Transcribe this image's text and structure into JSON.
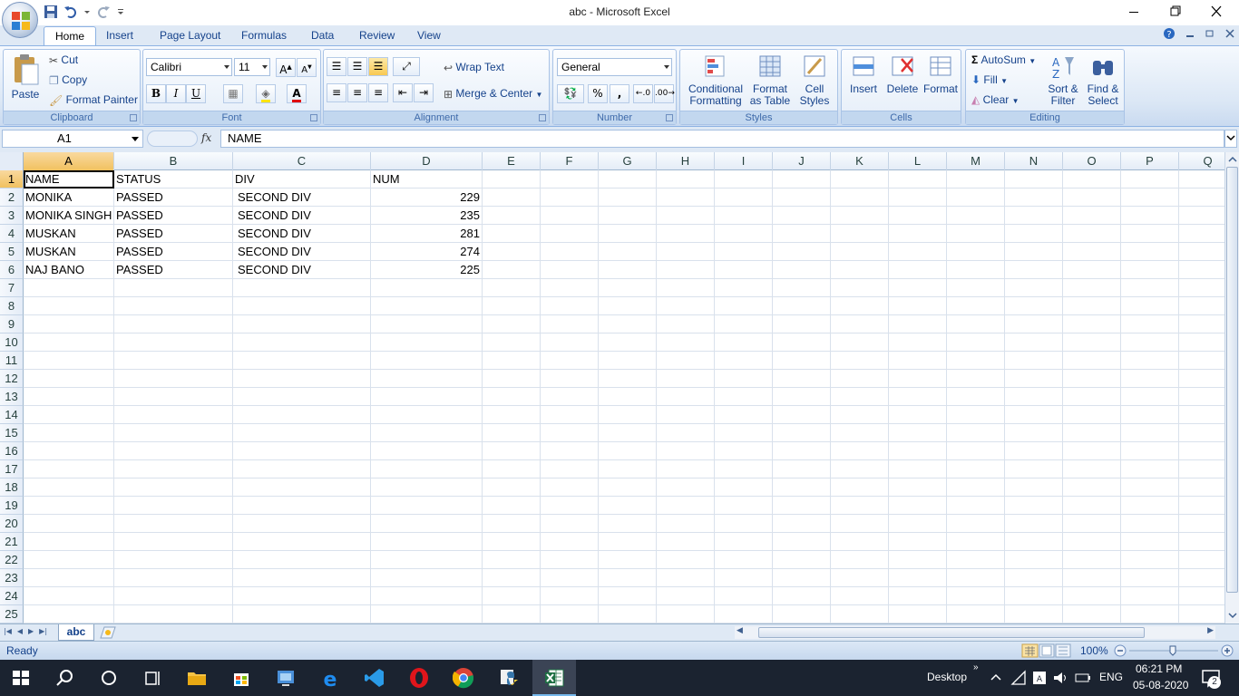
{
  "window": {
    "title": "abc - Microsoft Excel"
  },
  "tabs": [
    "Home",
    "Insert",
    "Page Layout",
    "Formulas",
    "Data",
    "Review",
    "View"
  ],
  "ribbon": {
    "clipboard": {
      "label": "Clipboard",
      "paste": "Paste",
      "cut": "Cut",
      "copy": "Copy",
      "format_painter": "Format Painter"
    },
    "font": {
      "label": "Font",
      "font_name": "Calibri",
      "font_size": "11",
      "bold": "B",
      "italic": "I",
      "underline": "U"
    },
    "alignment": {
      "label": "Alignment",
      "wrap_text": "Wrap Text",
      "merge_center": "Merge & Center"
    },
    "number": {
      "label": "Number",
      "format": "General",
      "percent": "%",
      "comma": ","
    },
    "styles": {
      "label": "Styles",
      "conditional_1": "Conditional",
      "conditional_2": "Formatting",
      "format_table_1": "Format",
      "format_table_2": "as Table",
      "cell_styles_1": "Cell",
      "cell_styles_2": "Styles"
    },
    "cells": {
      "label": "Cells",
      "insert": "Insert",
      "delete": "Delete",
      "format": "Format"
    },
    "editing": {
      "label": "Editing",
      "autosum": "AutoSum",
      "fill": "Fill",
      "clear": "Clear",
      "sort_1": "Sort &",
      "sort_2": "Filter",
      "find_1": "Find &",
      "find_2": "Select"
    }
  },
  "formula_bar": {
    "name_box": "A1",
    "fx": "fx",
    "content": "NAME"
  },
  "columns": [
    "A",
    "B",
    "C",
    "D",
    "E",
    "F",
    "G",
    "H",
    "I",
    "J",
    "K",
    "L",
    "M",
    "N",
    "O",
    "P",
    "Q"
  ],
  "rows": [
    "1",
    "2",
    "3",
    "4",
    "5",
    "6",
    "7",
    "8",
    "9",
    "10",
    "11",
    "12",
    "13",
    "14",
    "15",
    "16",
    "17",
    "18",
    "19",
    "20",
    "21",
    "22",
    "23",
    "24",
    "25"
  ],
  "cells": [
    [
      "NAME",
      "STATUS",
      "DIV",
      "NUM"
    ],
    [
      "MONIKA",
      "PASSED",
      "SECOND DIV",
      "229"
    ],
    [
      "MONIKA SINGH",
      "PASSED",
      "SECOND DIV",
      "235"
    ],
    [
      "MUSKAN",
      "PASSED",
      "SECOND DIV",
      "281"
    ],
    [
      "MUSKAN",
      "PASSED",
      "SECOND DIV",
      "274"
    ],
    [
      "NAJ BANO",
      "PASSED",
      "SECOND DIV",
      "225"
    ]
  ],
  "sheet": {
    "tab": "abc"
  },
  "status": {
    "text": "Ready",
    "zoom": "100%"
  },
  "taskbar": {
    "desktop": "Desktop",
    "lang": "ENG",
    "time": "06:21 PM",
    "date": "05-08-2020",
    "notifications": "2"
  },
  "colors": {
    "accent": "#15428b",
    "selected_header": "#f1c15f",
    "taskbar": "#1b2330"
  }
}
